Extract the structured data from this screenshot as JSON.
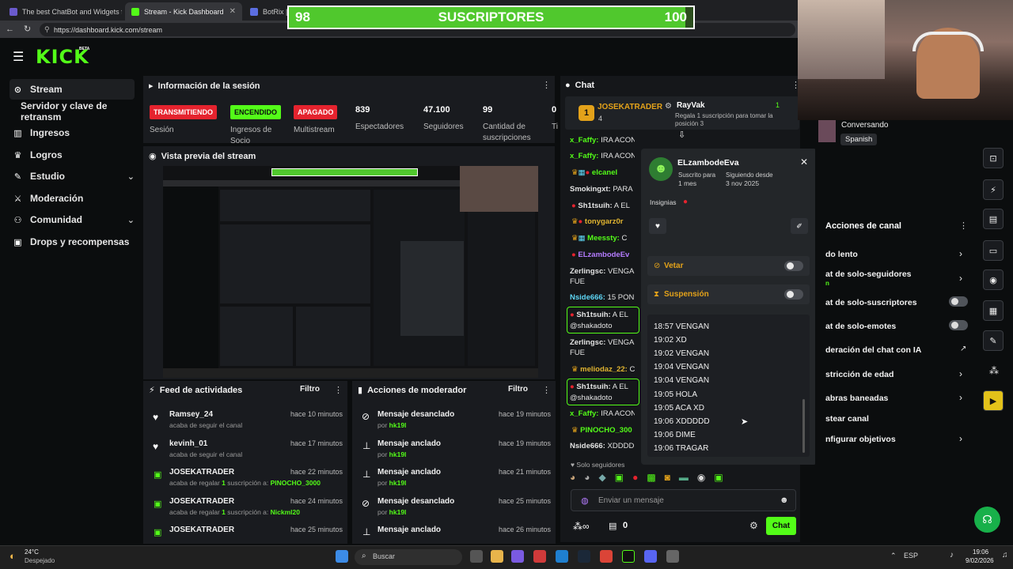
{
  "browser": {
    "tabs": [
      {
        "label": "The best ChatBot and Widgets for"
      },
      {
        "label": "Stream - Kick Dashboard"
      },
      {
        "label": "BotRix | Sor"
      }
    ],
    "url": "https://dashboard.kick.com/stream"
  },
  "overlay": {
    "current": "98",
    "label": "SUSCRIPTORES",
    "goal": "100",
    "progress_fraction": 0.98
  },
  "brand": {
    "logo": "KICK",
    "beta": "BETA",
    "accent": "#53fc18"
  },
  "sidebar": {
    "items": [
      {
        "label": "Stream",
        "icon": "stream-icon"
      },
      {
        "label": "Servidor y clave de retransm"
      },
      {
        "label": "Ingresos",
        "icon": "chart-icon"
      },
      {
        "label": "Logros",
        "icon": "trophy-icon"
      },
      {
        "label": "Estudio",
        "icon": "brush-icon"
      },
      {
        "label": "Moderación",
        "icon": "sword-icon"
      },
      {
        "label": "Comunidad",
        "icon": "people-icon"
      },
      {
        "label": "Drops y recompensas",
        "icon": "gift-icon"
      }
    ]
  },
  "session": {
    "title": "Información de la sesión",
    "badges": [
      "TRANSMITIENDO",
      "ENCENDIDO",
      "APAGADO"
    ],
    "badge_labels": [
      "Sesión",
      "Ingresos de Socio",
      "Multistream"
    ],
    "stats": [
      {
        "value": "839",
        "label": "Espectadores"
      },
      {
        "value": "47.100",
        "label": "Seguidores"
      },
      {
        "value": "99",
        "label": "Cantidad de suscripciones"
      },
      {
        "value": "0",
        "label": "Ti"
      }
    ]
  },
  "preview": {
    "title": "Vista previa del stream"
  },
  "feed": {
    "title": "Feed de actividades",
    "filter": "Filtro",
    "items": [
      {
        "name": "Ramsey_24",
        "text": "acaba de seguir el canal",
        "time": "hace 10 minutos"
      },
      {
        "name": "kevinh_01",
        "text": "acaba de seguir el canal",
        "time": "hace 17 minutos"
      },
      {
        "name": "JOSEKATRADER",
        "text": "acaba de regalar",
        "count": "1",
        "mid": "suscripción a:",
        "target": "PINOCHO_3000",
        "time": "hace 22 minutos"
      },
      {
        "name": "JOSEKATRADER",
        "text": "acaba de regalar",
        "count": "1",
        "mid": "suscripción a:",
        "target": "Nickml20",
        "time": "hace 24 minutos"
      },
      {
        "name": "JOSEKATRADER",
        "time": "hace 25 minutos"
      }
    ]
  },
  "modactions": {
    "title": "Acciones de moderador",
    "filter": "Filtro",
    "items": [
      {
        "action": "Mensaje desanclado",
        "by": "por",
        "mod": "hk19l",
        "time": "hace 19 minutos"
      },
      {
        "action": "Mensaje anclado",
        "by": "por",
        "mod": "hk19l",
        "time": "hace 19 minutos"
      },
      {
        "action": "Mensaje anclado",
        "by": "por",
        "mod": "hk19l",
        "time": "hace 21 minutos"
      },
      {
        "action": "Mensaje desanclado",
        "by": "por",
        "mod": "hk19l",
        "time": "hace 25 minutos"
      },
      {
        "action": "Mensaje anclado",
        "by": "por",
        "mod": "hk19l",
        "time": "hace 26 minutos"
      }
    ]
  },
  "chat": {
    "title": "Chat",
    "leader": {
      "rank": "1",
      "name": "JOSEKATRADER",
      "count": "4"
    },
    "gift": {
      "user": "RayVak",
      "count": "1",
      "text": "Regala 1 suscripción para tomar la posición 3"
    },
    "lines": [
      {
        "name": "x_Faffy:",
        "text": "IRA ACON",
        "color": "#53fc18"
      },
      {
        "name": "x_Faffy:",
        "text": "IRA ACON",
        "color": "#53fc18"
      },
      {
        "name": "elcanel",
        "text": "",
        "color": "#53fc18"
      },
      {
        "name": "Smokingxt:",
        "text": "PARA",
        "color": "#e3e3e3"
      },
      {
        "name": "Sh1tsuih:",
        "text": "A EL",
        "color": "#e3e3e3"
      },
      {
        "name": "tonygarz0r",
        "text": "",
        "color": "#e0b430"
      },
      {
        "name": "Meessty:",
        "text": "C",
        "color": "#53fc18"
      },
      {
        "name": "ELzambodeEv",
        "text": "",
        "color": "#b57cff"
      },
      {
        "name": "Zerlingsc:",
        "text": "VENGA FUE",
        "color": "#e3e3e3"
      },
      {
        "name": "Nside666:",
        "text": "15 PON",
        "color": "#5ed6f5"
      },
      {
        "name": "Sh1tsuih:",
        "text": "A EL @shakadoto",
        "color": "#e3e3e3"
      },
      {
        "name": "Zerlingsc:",
        "text": "VENGA FUE",
        "color": "#e3e3e3"
      },
      {
        "name": "meliodaz_22:",
        "text": "C",
        "color": "#e0b430"
      },
      {
        "name": "Sh1tsuih:",
        "text": "A EL @shakadoto",
        "color": "#e3e3e3"
      },
      {
        "name": "x_Faffy:",
        "text": "IRA ACON",
        "color": "#53fc18"
      },
      {
        "name": "PINOCHO_300",
        "text": "",
        "color": "#53fc18"
      },
      {
        "name": "Nside666:",
        "text": "XDDDD",
        "color": "#e3e3e3"
      }
    ],
    "followers_only": "Solo seguidores",
    "input_placeholder": "Enviar un mensaje",
    "points": "0",
    "send": "Chat"
  },
  "popup": {
    "user": "ELzambodeEva",
    "sub_label": "Suscrito para",
    "sub_value": "1 mes",
    "follow_label": "Siguiendo desde",
    "follow_value": "3 nov 2025",
    "badges_label": "Insignias",
    "ban": "Vetar",
    "timeout": "Suspensión",
    "history": [
      "18:57 VENGAN",
      "19:02 XD",
      "19:02 VENGAN",
      "19:04 VENGAN",
      "19:04 VENGAN",
      "19:05 HOLA",
      "19:05 ACA XD",
      "19:06 XDDDDD",
      "19:06 DIME",
      "19:06 TRAGAR"
    ]
  },
  "camera": {
    "status": "Conversando",
    "language": "Spanish"
  },
  "channel_actions": {
    "title": "Acciones de canal",
    "items": [
      {
        "label": "do lento",
        "kind": "chevron"
      },
      {
        "label": "at de solo-seguidores",
        "kind": "chevron"
      },
      {
        "label": "at de solo-suscriptores",
        "kind": "toggle"
      },
      {
        "label": "at de solo-emotes",
        "kind": "toggle"
      },
      {
        "label": "deración del chat con IA",
        "kind": "link"
      },
      {
        "label": "stricción de edad",
        "kind": "chevron"
      },
      {
        "label": "abras baneadas",
        "kind": "chevron"
      },
      {
        "label": "stear canal",
        "kind": "none"
      },
      {
        "label": "nfigurar objetivos",
        "kind": "chevron"
      }
    ]
  },
  "taskbar": {
    "weather_temp": "24°C",
    "weather_desc": "Despejado",
    "search": "Buscar",
    "time": "19:06",
    "date": "9/02/2026",
    "lang": "ESP"
  }
}
